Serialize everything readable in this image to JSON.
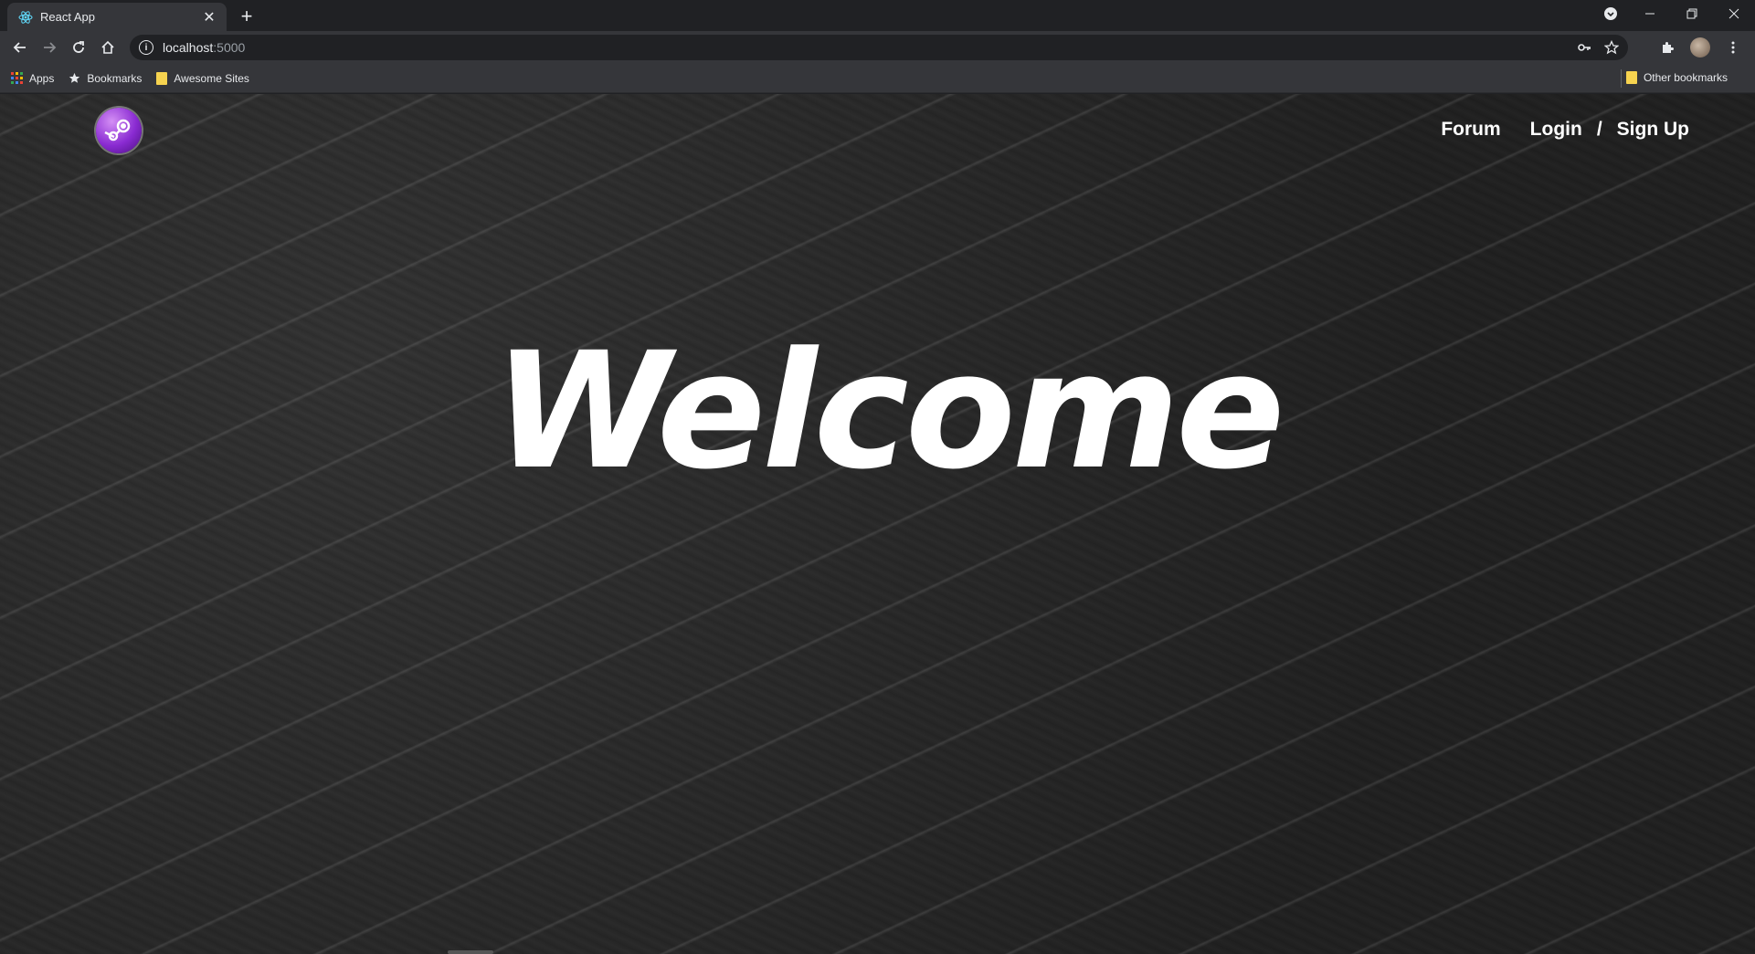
{
  "browser": {
    "tab": {
      "title": "React App",
      "close_icon": "close-icon",
      "favicon": "react-icon"
    },
    "new_tab_label": "+",
    "window_controls": [
      "minimize-icon",
      "restore-icon",
      "close-icon"
    ],
    "address": {
      "host": "localhost",
      "port": ":5000"
    },
    "bookmarks": [
      {
        "label": "Apps",
        "icon": "apps-grid-icon"
      },
      {
        "label": "Bookmarks",
        "icon": "star-icon"
      },
      {
        "label": "Awesome Sites",
        "icon": "folder-icon"
      }
    ],
    "other_bookmarks": {
      "label": "Other bookmarks",
      "icon": "folder-icon"
    }
  },
  "page": {
    "logo": "steam-logo-icon",
    "nav": {
      "forum": "Forum",
      "login": "Login",
      "separator": "/",
      "signup": "Sign Up"
    },
    "hero_title": "Welcome"
  },
  "colors": {
    "accent": "#8a2bd2",
    "bookmark_folder": "#f6d34f"
  }
}
